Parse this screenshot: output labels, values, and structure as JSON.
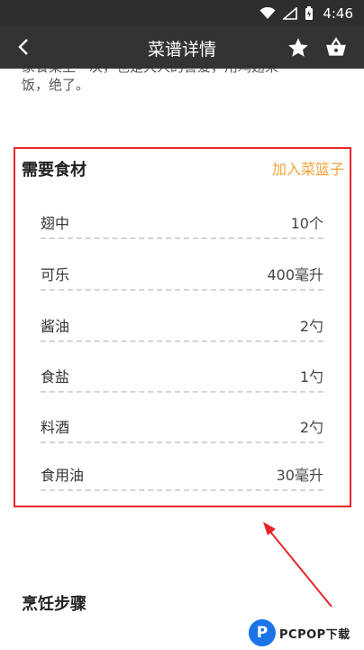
{
  "status_bar": {
    "time": "4:46",
    "icons": [
      "wifi-icon",
      "signal-icon",
      "battery-icon"
    ]
  },
  "app_bar": {
    "title": "菜谱详情",
    "icons": [
      "back-arrow-icon",
      "star-icon",
      "basket-icon"
    ]
  },
  "intro": {
    "partial_line": "家餐桌上一次，也是大人的喜爱，用鸡翅来",
    "line": "饭，绝了。"
  },
  "ingredients": {
    "title": "需要食材",
    "add_to_basket": "加入菜篮子",
    "items": [
      {
        "name": "翅中",
        "amount": "10个"
      },
      {
        "name": "可乐",
        "amount": "400毫升"
      },
      {
        "name": "酱油",
        "amount": "2勺"
      },
      {
        "name": "食盐",
        "amount": "1勺"
      },
      {
        "name": "料酒",
        "amount": "2勺"
      },
      {
        "name": "食用油",
        "amount": "30毫升"
      }
    ]
  },
  "steps": {
    "title": "烹饪步骤"
  },
  "watermark": {
    "logo_letter": "P",
    "text": "PCPOP下载"
  },
  "colors": {
    "status_bar": "#2e2e2e",
    "app_bar": "#333333",
    "accent": "#f3a23b",
    "annotation_red": "#e8262a"
  }
}
